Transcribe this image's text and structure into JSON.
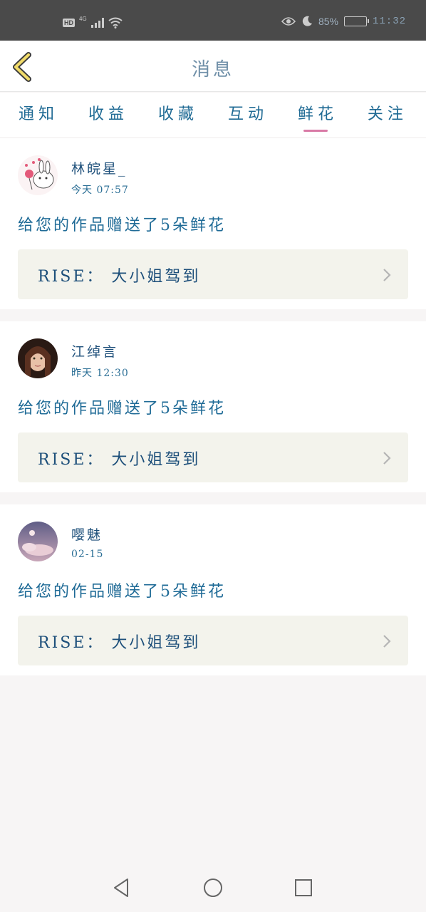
{
  "status_bar": {
    "hd": "HD",
    "network": "4G",
    "battery_text": "85%",
    "battery_level": 0.85,
    "time": "11:32"
  },
  "header": {
    "title": "消息",
    "back_icon": "chevron-left-icon"
  },
  "tabs": [
    {
      "label": "通知",
      "active": false
    },
    {
      "label": "收益",
      "active": false
    },
    {
      "label": "收藏",
      "active": false
    },
    {
      "label": "互动",
      "active": false
    },
    {
      "label": "鲜花",
      "active": true
    },
    {
      "label": "关注",
      "active": false
    }
  ],
  "messages": [
    {
      "user": "林皖星_",
      "time": "今天 07:57",
      "text": "给您的作品赠送了5朵鲜花",
      "work": "RISE： 大小姐驾到"
    },
    {
      "user": "江绰言",
      "time": "昨天 12:30",
      "text": "给您的作品赠送了5朵鲜花",
      "work": "RISE： 大小姐驾到"
    },
    {
      "user": "嘤魅",
      "time": "02-15",
      "text": "给您的作品赠送了5朵鲜花",
      "work": "RISE： 大小姐驾到"
    }
  ],
  "colors": {
    "accent": "#d97aa6",
    "text_primary": "#1f5e8a",
    "card_bg": "#f3f3ec"
  }
}
